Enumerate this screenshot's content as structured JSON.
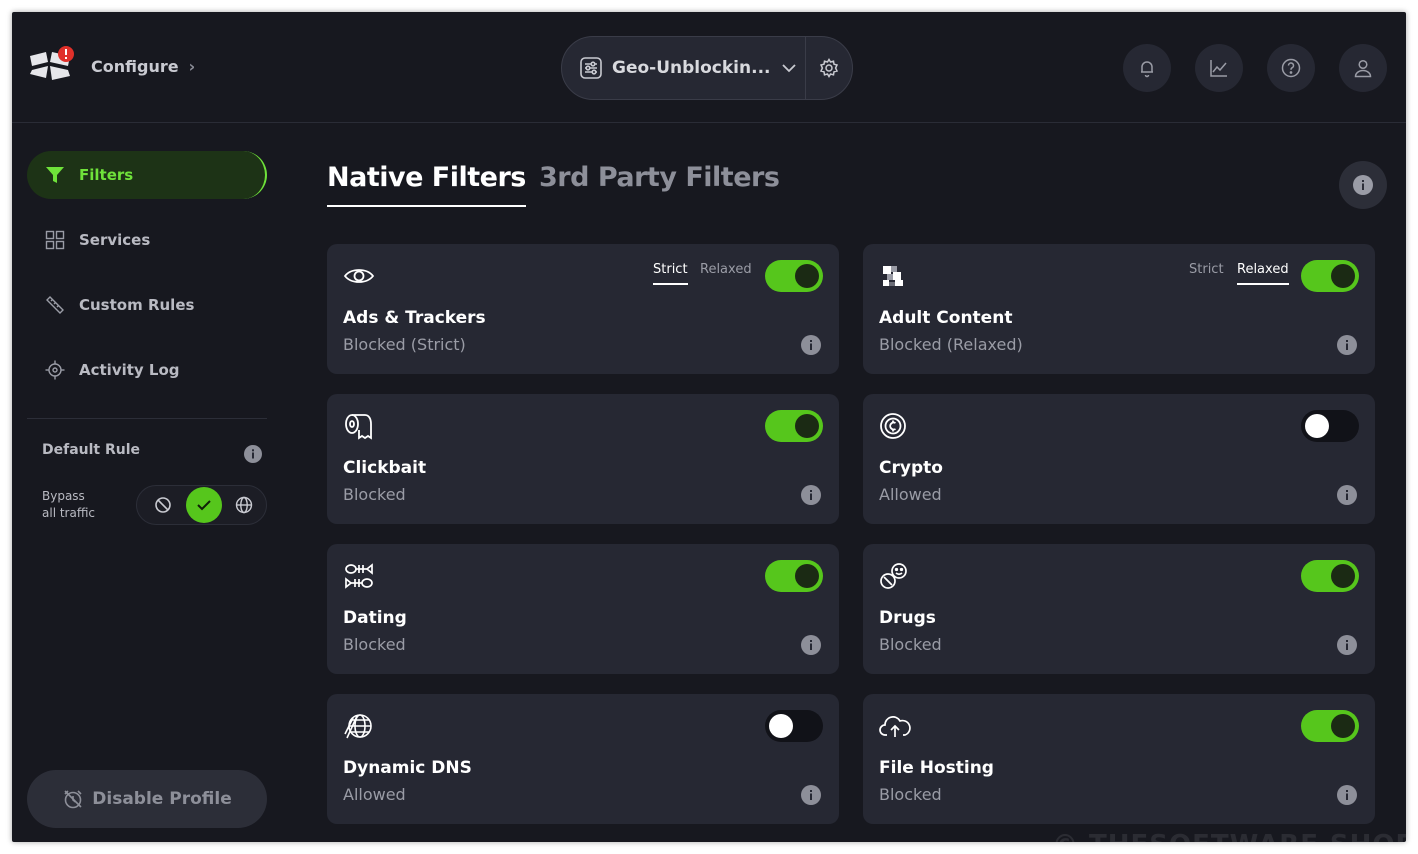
{
  "header": {
    "breadcrumb": "Configure",
    "profile_name": "Geo-Unblockin..."
  },
  "sidebar": {
    "items": [
      {
        "label": "Filters",
        "icon": "funnel-icon",
        "active": true
      },
      {
        "label": "Services",
        "icon": "grid-icon",
        "active": false
      },
      {
        "label": "Custom Rules",
        "icon": "ruler-icon",
        "active": false
      },
      {
        "label": "Activity Log",
        "icon": "crosshair-icon",
        "active": false
      }
    ],
    "default_rule": {
      "title": "Default Rule",
      "bypass_line1": "Bypass",
      "bypass_line2": "all traffic",
      "options": [
        "block",
        "bypass",
        "redirect"
      ],
      "selected": "bypass"
    },
    "disable_label": "Disable Profile"
  },
  "tabs": {
    "native": "Native Filters",
    "third_party": "3rd Party Filters"
  },
  "filters": [
    {
      "title": "Ads & Trackers",
      "status": "Blocked (Strict)",
      "enabled": true,
      "icon": "eye-icon",
      "modes": [
        "Strict",
        "Relaxed"
      ],
      "mode_selected": "Strict"
    },
    {
      "title": "Adult Content",
      "status": "Blocked (Relaxed)",
      "enabled": true,
      "icon": "pixelated-icon",
      "modes": [
        "Strict",
        "Relaxed"
      ],
      "mode_selected": "Relaxed"
    },
    {
      "title": "Clickbait",
      "status": "Blocked",
      "enabled": true,
      "icon": "toilet-paper-icon"
    },
    {
      "title": "Crypto",
      "status": "Allowed",
      "enabled": false,
      "icon": "coin-icon"
    },
    {
      "title": "Dating",
      "status": "Blocked",
      "enabled": true,
      "icon": "fish-bones-icon"
    },
    {
      "title": "Drugs",
      "status": "Blocked",
      "enabled": true,
      "icon": "pills-icon"
    },
    {
      "title": "Dynamic DNS",
      "status": "Allowed",
      "enabled": false,
      "icon": "globe-network-icon"
    },
    {
      "title": "File Hosting",
      "status": "Blocked",
      "enabled": true,
      "icon": "cloud-upload-icon"
    }
  ],
  "colors": {
    "accent": "#56c61c",
    "background": "#17181f",
    "card": "#262833"
  },
  "watermark": "© THESOFTWARE.SHOP"
}
